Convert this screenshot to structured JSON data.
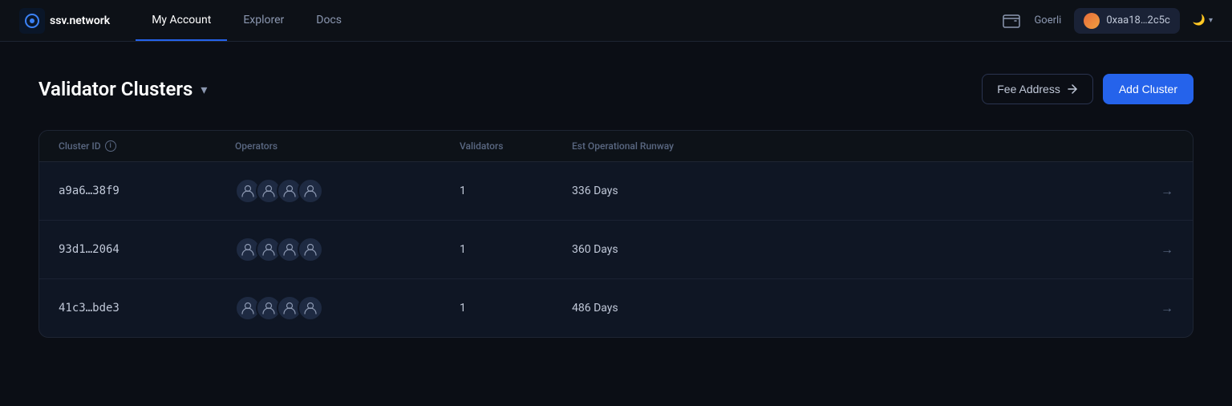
{
  "nav": {
    "logo_text": "ssv.network",
    "links": [
      {
        "id": "my-account",
        "label": "My Account",
        "active": true
      },
      {
        "id": "explorer",
        "label": "Explorer",
        "active": false
      },
      {
        "id": "docs",
        "label": "Docs",
        "active": false
      }
    ],
    "network": "Goerli",
    "address": "0xaa18…2c5c",
    "theme_icon": "🌙"
  },
  "page": {
    "title": "Validator Clusters",
    "fee_address_label": "Fee Address",
    "add_cluster_label": "Add Cluster"
  },
  "table": {
    "columns": {
      "cluster_id": "Cluster ID",
      "operators": "Operators",
      "validators": "Validators",
      "runway": "Est Operational Runway"
    },
    "rows": [
      {
        "id": "a9a6…38f9",
        "validators": "1",
        "runway": "336 Days",
        "operators_count": 4
      },
      {
        "id": "93d1…2064",
        "validators": "1",
        "runway": "360 Days",
        "operators_count": 4
      },
      {
        "id": "41c3…bde3",
        "validators": "1",
        "runway": "486 Days",
        "operators_count": 4
      }
    ]
  }
}
